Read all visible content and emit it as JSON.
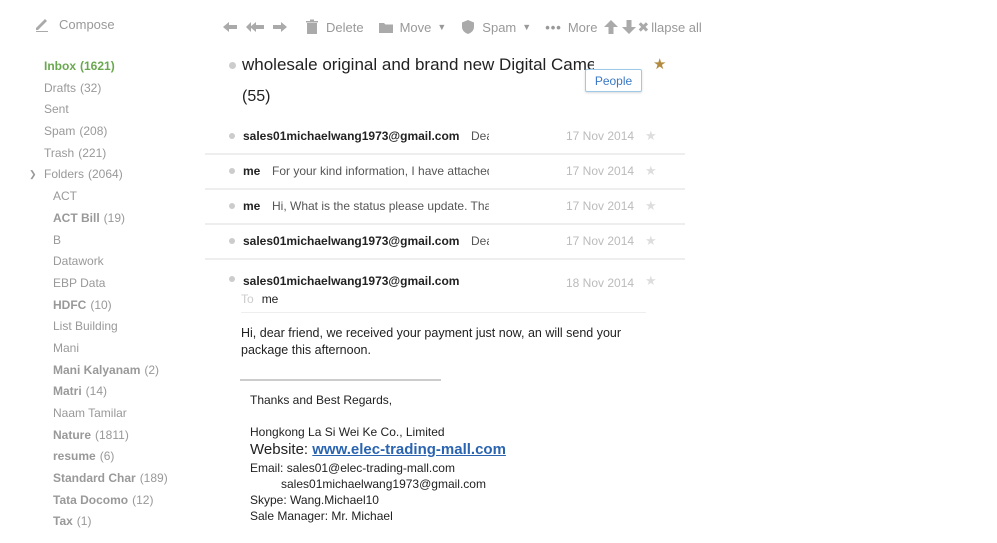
{
  "sidebar": {
    "compose_label": "Compose",
    "items": [
      {
        "label": "Inbox",
        "count": "(1621)"
      },
      {
        "label": "Drafts",
        "count": "(32)"
      },
      {
        "label": "Sent",
        "count": ""
      },
      {
        "label": "Spam",
        "count": "(208)"
      },
      {
        "label": "Trash",
        "count": "(221)"
      },
      {
        "label": "Folders",
        "count": "(2064)"
      }
    ],
    "folders": [
      {
        "label": "ACT",
        "count": ""
      },
      {
        "label": "ACT Bill",
        "count": "(19)"
      },
      {
        "label": "B",
        "count": ""
      },
      {
        "label": "Datawork",
        "count": ""
      },
      {
        "label": "EBP Data",
        "count": ""
      },
      {
        "label": "HDFC",
        "count": "(10)"
      },
      {
        "label": "List Building",
        "count": ""
      },
      {
        "label": "Mani",
        "count": ""
      },
      {
        "label": "Mani Kalyanam",
        "count": "(2)"
      },
      {
        "label": "Matri",
        "count": "(14)"
      },
      {
        "label": "Naam Tamilar",
        "count": ""
      },
      {
        "label": "Nature",
        "count": "(1811)"
      },
      {
        "label": "resume",
        "count": "(6)"
      },
      {
        "label": "Standard Char",
        "count": "(189)"
      },
      {
        "label": "Tata Docomo",
        "count": "(12)"
      },
      {
        "label": "Tax",
        "count": "(1)"
      }
    ]
  },
  "toolbar": {
    "delete_label": "Delete",
    "move_label": "Move",
    "spam_label": "Spam",
    "more_label": "More",
    "collapse_label": "llapse all"
  },
  "thread": {
    "subject": "wholesale original and brand new Digital Camera",
    "count": "(55)",
    "people_label": "People",
    "messages": [
      {
        "from": "sales01michaelwang1973@gmail.com",
        "snippet": "Dear",
        "date": "17 Nov 2014"
      },
      {
        "from": "me",
        "snippet": "For your kind information, I have attached",
        "date": "17 Nov 2014"
      },
      {
        "from": "me",
        "snippet": "Hi, What is the status please update. Thanks",
        "date": "17 Nov 2014"
      },
      {
        "from": "sales01michaelwang1973@gmail.com",
        "snippet": "Dear",
        "date": "17 Nov 2014"
      }
    ],
    "open_message": {
      "from": "sales01michaelwang1973@gmail.com",
      "date": "18 Nov 2014",
      "to_label": "To",
      "to": "me",
      "body": "Hi, dear friend, we received your payment just now, an will send your package this afternoon.",
      "signature": {
        "regards": "Thanks and Best Regards,",
        "company": "Hongkong La Si Wei Ke Co., Limited",
        "website_label": "Website:",
        "website": "www.elec-trading-mall.com",
        "email_label": "Email:",
        "email1": "sales01@elec-trading-mall.com",
        "email2": "sales01michaelwang1973@gmail.com",
        "skype": "Skype: Wang.Michael10",
        "manager": "Sale Manager: Mr. Michael"
      }
    }
  },
  "colors": {
    "accent_green": "#6aa84f",
    "link_blue": "#2a64b0",
    "star_gold": "#b38b3f"
  }
}
